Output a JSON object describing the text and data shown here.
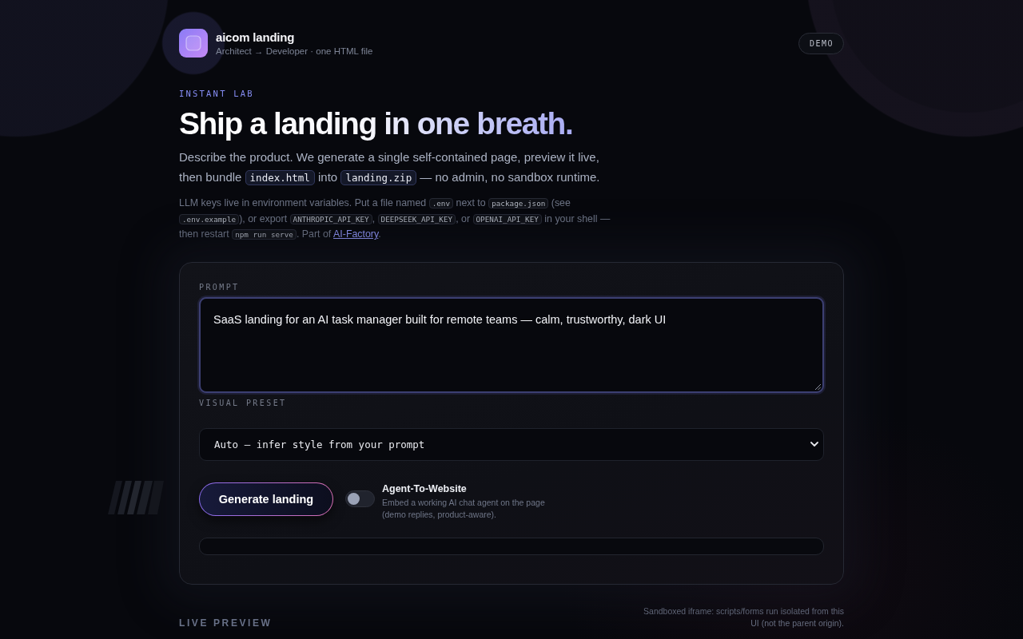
{
  "brand": {
    "name": "aicom landing",
    "tagline": "Architect → Developer · one HTML file"
  },
  "badge": "DEMO",
  "hero": {
    "eyebrow": "INSTANT LAB",
    "title": "Ship a landing in one breath.",
    "intro": [
      {
        "kind": "text",
        "text": "Describe the product. We generate a single self-contained page, preview it live, then bundle "
      },
      {
        "kind": "code",
        "text": "index.html"
      },
      {
        "kind": "text",
        "text": " into "
      },
      {
        "kind": "code",
        "text": "landing.zip"
      },
      {
        "kind": "text",
        "text": " — no admin, no sandbox runtime."
      }
    ],
    "note": [
      {
        "kind": "text",
        "text": "LLM keys live in environment variables. Put a file named "
      },
      {
        "kind": "code",
        "text": ".env"
      },
      {
        "kind": "text",
        "text": " next to "
      },
      {
        "kind": "code",
        "text": "package.json"
      },
      {
        "kind": "text",
        "text": " (see "
      },
      {
        "kind": "code",
        "text": ".env.example"
      },
      {
        "kind": "text",
        "text": "), or export "
      },
      {
        "kind": "code",
        "text": "ANTHROPIC_API_KEY"
      },
      {
        "kind": "text",
        "text": ", "
      },
      {
        "kind": "code",
        "text": "DEEPSEEK_API_KEY"
      },
      {
        "kind": "text",
        "text": ", or "
      },
      {
        "kind": "code",
        "text": "OPENAI_API_KEY"
      },
      {
        "kind": "text",
        "text": " in your shell — then restart "
      },
      {
        "kind": "code",
        "text": "npm run serve"
      },
      {
        "kind": "text",
        "text": ". Part of "
      },
      {
        "kind": "link",
        "text": "AI-Factory"
      },
      {
        "kind": "text",
        "text": "."
      }
    ]
  },
  "form": {
    "prompt": {
      "label": "PROMPT",
      "value": "SaaS landing for an AI task manager built for remote teams — calm, trustworthy, dark UI"
    },
    "preset": {
      "label": "VISUAL PRESET",
      "value": "Auto — infer style from your prompt"
    },
    "generate_button": "Generate landing",
    "agent_toggle": {
      "label": "Agent-To-Website",
      "description": "Embed a working AI chat agent on the page (demo replies, product-aware).",
      "on": false
    }
  },
  "live_preview": {
    "heading": "LIVE PREVIEW",
    "note": "Sandboxed iframe: scripts/forms run isolated from this UI (not the parent origin)."
  }
}
